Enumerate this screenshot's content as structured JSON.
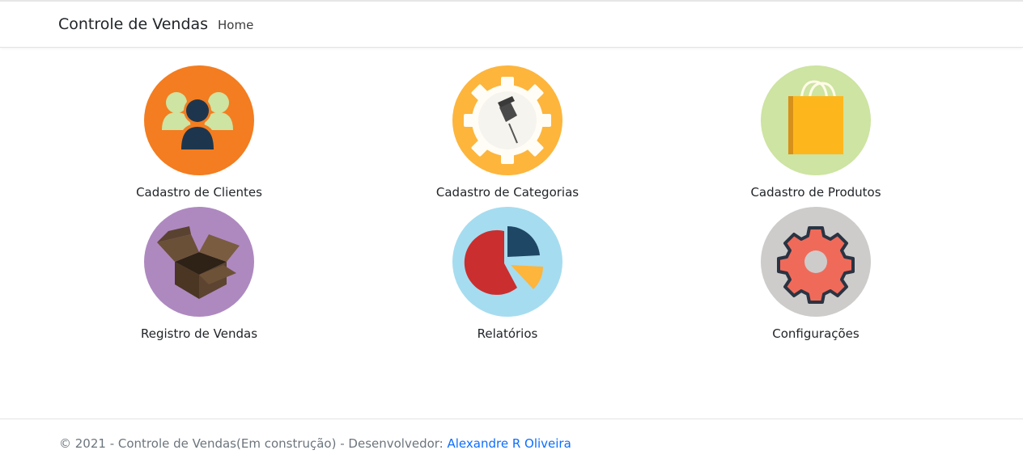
{
  "navbar": {
    "brand": "Controle de Vendas",
    "home_label": "Home"
  },
  "tiles": [
    {
      "label": "Cadastro de Clientes",
      "icon": "users-icon",
      "circle_color": "#f37d20"
    },
    {
      "label": "Cadastro de Categorias",
      "icon": "pushpin-gear-icon",
      "circle_color": "#fdb53c"
    },
    {
      "label": "Cadastro de Produtos",
      "icon": "shopping-bag-icon",
      "circle_color": "#cde4a2"
    },
    {
      "label": "Registro de Vendas",
      "icon": "open-box-icon",
      "circle_color": "#ae89c0"
    },
    {
      "label": "Relatórios",
      "icon": "pie-chart-icon",
      "circle_color": "#a6dcef"
    },
    {
      "label": "Configurações",
      "icon": "gear-icon",
      "circle_color": "#cdcccb"
    }
  ],
  "footer": {
    "text": "© 2021 - Controle de Vendas(Em construção) - Desenvolvedor: ",
    "developer_link": "Alexandre R Oliveira"
  }
}
